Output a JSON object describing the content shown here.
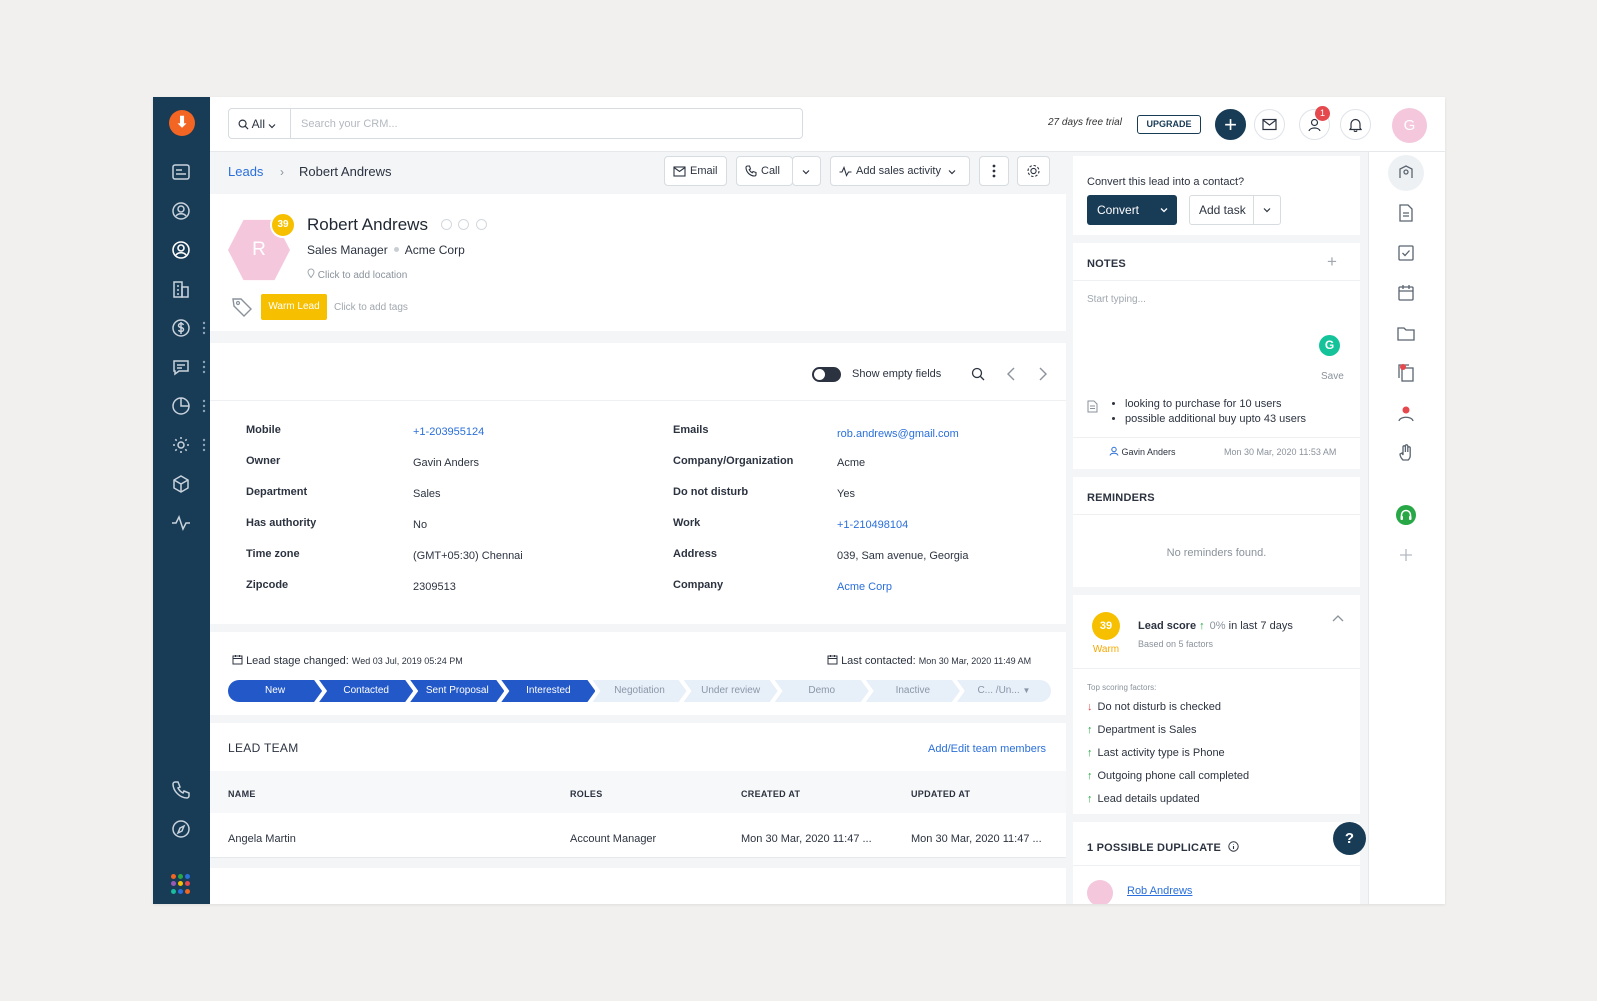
{
  "app": {
    "logo_glyph": "⬇",
    "brand_color": "#183b56",
    "accent_color": "#2a6fdb"
  },
  "topbar": {
    "scope_label": "All",
    "search_placeholder": "Search your CRM...",
    "trial_text": "27 days free trial",
    "upgrade_label": "UPGRADE",
    "plus_label": "+",
    "notification_count": "1",
    "avatar_initial": "G"
  },
  "breadcrumb": {
    "parent": "Leads",
    "separator": "›",
    "current": "Robert Andrews"
  },
  "toolbar": {
    "email_label": "Email",
    "call_label": "Call",
    "sales_activity_label": "Add sales activity"
  },
  "lead": {
    "initial": "R",
    "score": "39",
    "name": "Robert Andrews",
    "title": "Sales Manager",
    "company": "Acme Corp",
    "location_placeholder": "Click to add location",
    "tag": "Warm Lead",
    "add_tags": "Click to add tags"
  },
  "fields": {
    "show_empty_label": "Show empty fields",
    "left": [
      {
        "label": "Mobile",
        "value": "+1-203955124",
        "link": true
      },
      {
        "label": "Owner",
        "value": "Gavin Anders",
        "link": false
      },
      {
        "label": "Department",
        "value": "Sales",
        "link": false
      },
      {
        "label": "Has authority",
        "value": "No",
        "link": false
      },
      {
        "label": "Time zone",
        "value": "(GMT+05:30) Chennai",
        "link": false
      },
      {
        "label": "Zipcode",
        "value": "2309513",
        "link": false
      }
    ],
    "right": [
      {
        "label": "Emails",
        "value": "rob.andrews@gmail.com",
        "link": true
      },
      {
        "label": "Company/Organization",
        "value": "Acme",
        "link": false
      },
      {
        "label": "Do not disturb",
        "value": "Yes",
        "link": false
      },
      {
        "label": "Work",
        "value": "+1-210498104",
        "link": true
      },
      {
        "label": "Address",
        "value": "039, Sam avenue, Georgia",
        "link": false
      },
      {
        "label": "Company",
        "value": "Acme Corp",
        "link": true
      }
    ]
  },
  "stage": {
    "changed_label": "Lead stage changed:",
    "changed_date": "Wed 03 Jul, 2019 05:24 PM",
    "contacted_label": "Last contacted:",
    "contacted_date": "Mon 30 Mar, 2020 11:49 AM",
    "stages": [
      "New",
      "Contacted",
      "Sent Proposal",
      "Interested",
      "Negotiation",
      "Under review",
      "Demo",
      "Inactive",
      "C... /Un..."
    ],
    "active_count": 4
  },
  "lead_team": {
    "title": "LEAD TEAM",
    "edit_link": "Add/Edit team members",
    "columns": [
      "NAME",
      "ROLES",
      "CREATED AT",
      "UPDATED AT"
    ],
    "rows": [
      [
        "Angela Martin",
        "Account Manager",
        "Mon 30 Mar, 2020 11:47 ...",
        "Mon 30 Mar, 2020 11:47 ..."
      ]
    ]
  },
  "convert": {
    "prompt": "Convert this lead into a contact?",
    "convert_label": "Convert",
    "add_task_label": "Add task"
  },
  "notes": {
    "title": "NOTES",
    "placeholder": "Start typing...",
    "grammarly_glyph": "G",
    "save_label": "Save",
    "bullets": [
      "looking to purchase for 10 users",
      "possible additional buy upto 43 users"
    ],
    "author": "Gavin Anders",
    "timestamp": "Mon 30 Mar, 2020 11:53 AM"
  },
  "reminders": {
    "title": "REMINDERS",
    "empty_text": "No reminders found."
  },
  "lead_score": {
    "value": "39",
    "label": "Warm",
    "title": "Lead score",
    "change": "0%",
    "period": "in last 7 days",
    "basis": "Based on 5 factors",
    "factors_title": "Top scoring factors:",
    "factors": [
      {
        "text": "Do not disturb is checked",
        "direction": "down"
      },
      {
        "text": "Department is Sales",
        "direction": "up"
      },
      {
        "text": "Last activity type is Phone",
        "direction": "up"
      },
      {
        "text": "Outgoing phone call completed",
        "direction": "up"
      },
      {
        "text": "Lead details updated",
        "direction": "up"
      }
    ]
  },
  "duplicate": {
    "title": "1 POSSIBLE DUPLICATE",
    "name": "Rob Andrews"
  },
  "help_label": "?"
}
